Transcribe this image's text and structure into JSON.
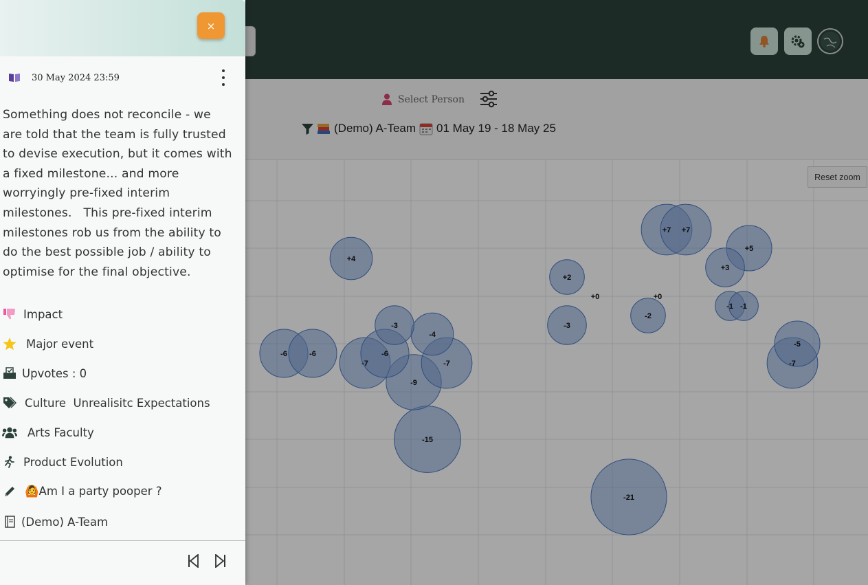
{
  "filters": {
    "select_person": "Select Person",
    "summary_team": "(Demo) A-Team",
    "summary_dates": "01 May 19 - 18 May 25"
  },
  "chart": {
    "reset_zoom": "Reset zoom"
  },
  "chart_data": {
    "type": "scatter",
    "title": "",
    "xlabel": "",
    "ylabel": "",
    "grid": true,
    "points": [
      {
        "label": "+4",
        "value": 4
      },
      {
        "label": "-6",
        "value": -6
      },
      {
        "label": "-6",
        "value": -6
      },
      {
        "label": "-3",
        "value": -3
      },
      {
        "label": "-4",
        "value": -4
      },
      {
        "label": "-7",
        "value": -7
      },
      {
        "label": "-6",
        "value": -6
      },
      {
        "label": "-7",
        "value": -7
      },
      {
        "label": "-9",
        "value": -9
      },
      {
        "label": "-15",
        "value": -15
      },
      {
        "label": "+2",
        "value": 2
      },
      {
        "label": "+0",
        "value": 0
      },
      {
        "label": "-3",
        "value": -3
      },
      {
        "label": "+0",
        "value": 0
      },
      {
        "label": "-2",
        "value": -2
      },
      {
        "label": "-21",
        "value": -21
      },
      {
        "label": "+7",
        "value": 7
      },
      {
        "label": "+7",
        "value": 7
      },
      {
        "label": "+5",
        "value": 5
      },
      {
        "label": "+3",
        "value": 3
      },
      {
        "label": "-1",
        "value": -1
      },
      {
        "label": "-1",
        "value": -1
      },
      {
        "label": "-5",
        "value": -5
      },
      {
        "label": "-7",
        "value": -7
      }
    ]
  },
  "panel": {
    "date": "30 May 2024 23:59",
    "text_lines": [
      "Something does not reconcile - we",
      "are told that the team is fully trusted",
      "to devise execution, but it comes with",
      "a fixed milestone... and more",
      "worryingly pre-fixed interim",
      "milestones.   This pre-fixed interim",
      "milestones rob us from the ability to",
      "do the best possible job / ability to",
      "optimise for the final objective."
    ],
    "impact": "Impact",
    "major_event": "Major event",
    "upvotes": "Upvotes : 0",
    "tags": "Culture  Unrealisitc Expectations",
    "group": "Arts Faculty",
    "activity": "Product Evolution",
    "author": "🙆Am I a party pooper ?",
    "team": "(Demo) A-Team",
    "close_label": "×"
  },
  "colors": {
    "header_bg": "#2d423b",
    "bubble_fill": "#7ea1d6",
    "bubble_stroke": "#4a78c2",
    "close_btn": "#ef9732"
  }
}
